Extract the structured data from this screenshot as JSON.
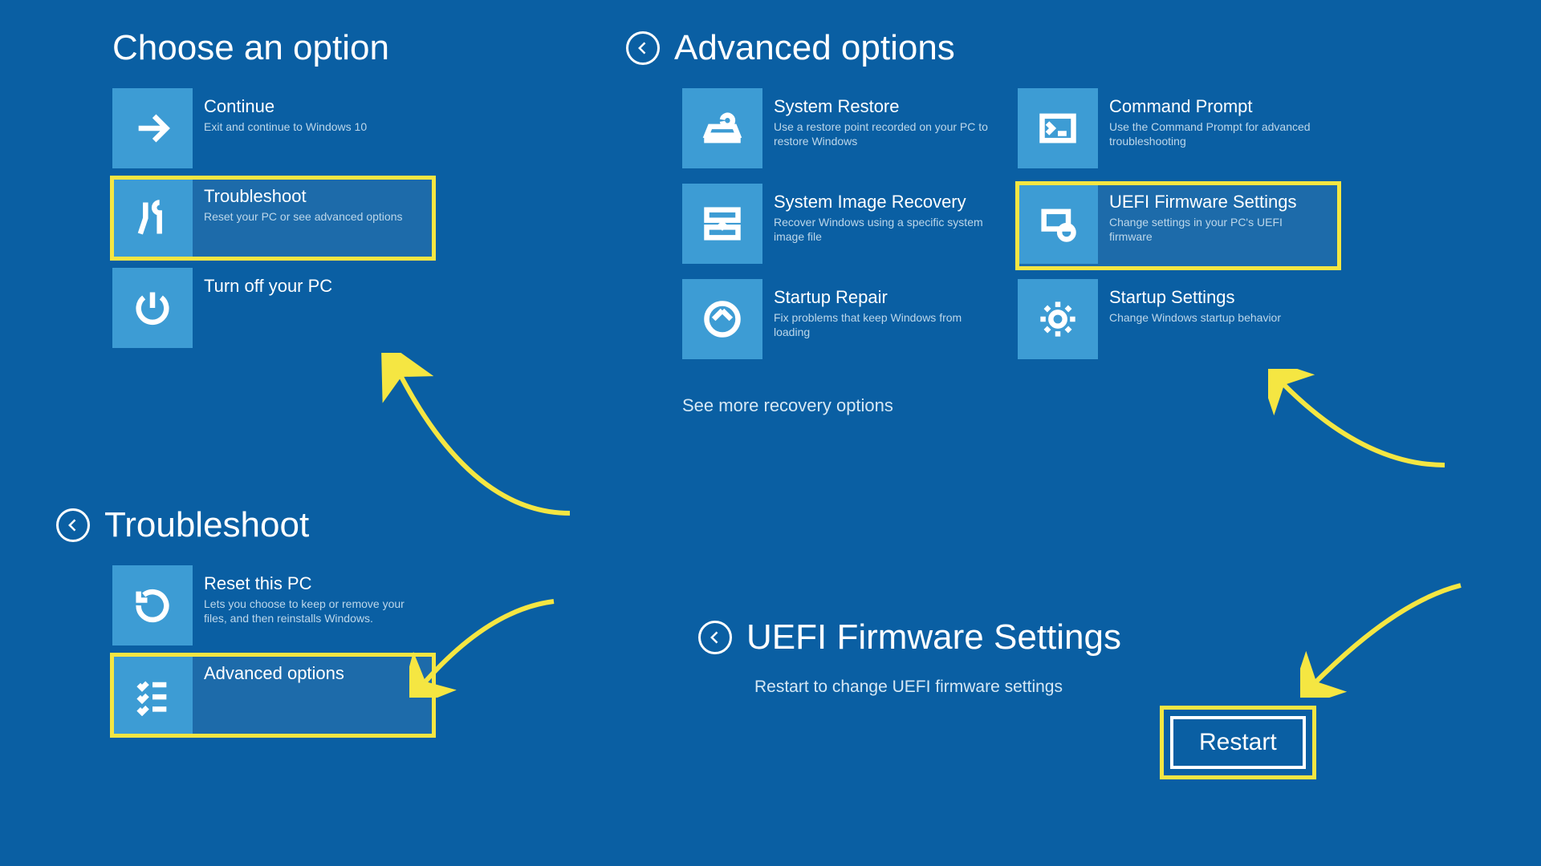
{
  "panel1": {
    "title": "Choose an option",
    "continue": {
      "title": "Continue",
      "desc": "Exit and continue to Windows 10"
    },
    "troubleshoot": {
      "title": "Troubleshoot",
      "desc": "Reset your PC or see advanced options"
    },
    "turnoff": {
      "title": "Turn off your PC"
    }
  },
  "panel2": {
    "title": "Advanced options",
    "systemRestore": {
      "title": "System Restore",
      "desc": "Use a restore point recorded on your PC to restore Windows"
    },
    "commandPrompt": {
      "title": "Command Prompt",
      "desc": "Use the Command Prompt for advanced troubleshooting"
    },
    "systemImage": {
      "title": "System Image Recovery",
      "desc": "Recover Windows using a specific system image file"
    },
    "uefi": {
      "title": "UEFI Firmware Settings",
      "desc": "Change settings in your PC's UEFI firmware"
    },
    "startupRepair": {
      "title": "Startup Repair",
      "desc": "Fix problems that keep Windows from loading"
    },
    "startupSettings": {
      "title": "Startup Settings",
      "desc": "Change Windows startup behavior"
    },
    "seeMore": "See more recovery options"
  },
  "panel3": {
    "title": "Troubleshoot",
    "reset": {
      "title": "Reset this PC",
      "desc": "Lets you choose to keep or remove your files, and then reinstalls Windows."
    },
    "advanced": {
      "title": "Advanced options"
    }
  },
  "panel4": {
    "title": "UEFI Firmware Settings",
    "desc": "Restart to change UEFI firmware settings",
    "button": "Restart"
  }
}
